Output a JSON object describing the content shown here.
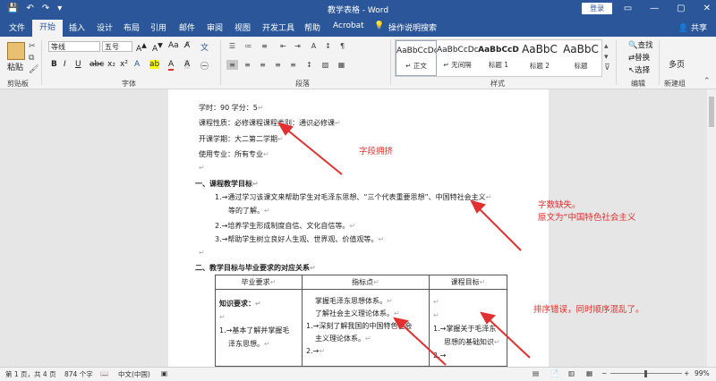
{
  "window": {
    "title": "教学表格 - Word",
    "login_label": "登录",
    "minimize_icon": "—",
    "restore_icon": "▢",
    "close_icon": "✕"
  },
  "qat": {
    "save_icon": "save-icon",
    "undo_icon": "undo-icon",
    "redo_icon": "redo-icon"
  },
  "tabs": [
    {
      "label": "文件"
    },
    {
      "label": "开始"
    },
    {
      "label": "插入"
    },
    {
      "label": "设计"
    },
    {
      "label": "布局"
    },
    {
      "label": "引用"
    },
    {
      "label": "邮件"
    },
    {
      "label": "审阅"
    },
    {
      "label": "视图"
    },
    {
      "label": "开发工具"
    },
    {
      "label": "帮助"
    },
    {
      "label": "Acrobat"
    },
    {
      "label": "操作说明搜索"
    }
  ],
  "share_label": "共享",
  "ribbon": {
    "clipboard": {
      "paste_label": "粘贴",
      "group_label": "剪贴板"
    },
    "font": {
      "font_name": "等线",
      "font_size": "五号",
      "group_label": "字体"
    },
    "paragraph": {
      "group_label": "段落"
    },
    "styles": {
      "group_label": "样式",
      "items": [
        {
          "sample": "AaBbCcDc",
          "name": "↵ 正文"
        },
        {
          "sample": "AaBbCcDc",
          "name": "↵ 无间隔"
        },
        {
          "sample": "AaBbCcD",
          "name": "标题 1"
        },
        {
          "sample": "AaBbC",
          "name": "标题 2"
        },
        {
          "sample": "AaBbC",
          "name": "标题"
        }
      ]
    },
    "editing": {
      "find": "查找",
      "replace": "替换",
      "select": "选择",
      "group_label": "编辑"
    },
    "newgroup": {
      "label": "多页",
      "group_label": "新建组"
    }
  },
  "doc": {
    "line1": "学时：90 学分：5",
    "line2": "课程性质：必修课程课程类别：通识必修课",
    "line3": "开课学期：大二第二学期",
    "line4": "使用专业：所有专业",
    "sec1_title": "一、课程教学目标",
    "obj1": "1.→通过学习该课文来帮助学生对毛泽东思想、“三个代表重要思想”、中国特社会主义",
    "obj1b": "等的了解。",
    "obj2": "2.→培养学生形成制度自信、文化自信等。",
    "obj3": "3.→帮助学生树立良好人生观、世界观、价值观等。",
    "sec2_title": "二、教学目标与毕业要求的对应关系",
    "table": {
      "headers": [
        "毕业要求",
        "指标点",
        "课程目标"
      ],
      "col1": [
        "知识要求：",
        "1.→基本了解并掌握毛",
        "泽东思想。"
      ],
      "col2": [
        "掌握毛泽东思想体系。",
        "了解社会主义理论体系。",
        "1.→深刻了解我国的中国特色社会",
        "主义理论体系。",
        "2.→"
      ],
      "col3": [
        "1.→掌握关于毛泽东",
        "思想的基础知识",
        "2.→"
      ]
    }
  },
  "annotations": {
    "a1": "字段拥挤",
    "a2": "字数缺失。",
    "a3": "原文为“中国特色社会主义",
    "a4": "排序错误，同时顺序混乱了。",
    "color": "#e03030"
  },
  "status": {
    "page": "第 1 页，共 4 页",
    "words": "874 个字",
    "lang": "中文(中国)",
    "zoom": "99%"
  }
}
